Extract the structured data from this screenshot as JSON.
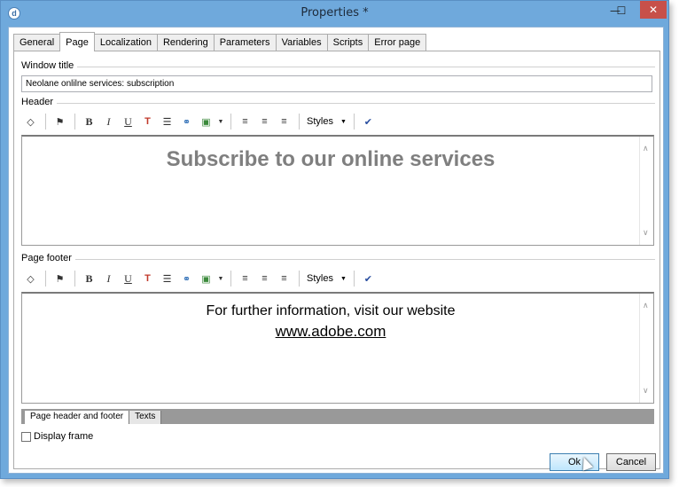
{
  "window": {
    "title": "Properties *",
    "minimize_glyph": "—",
    "maximize_glyph": "☐",
    "close_glyph": "✕",
    "app_icon_glyph": "d"
  },
  "tabs": [
    {
      "label": "General"
    },
    {
      "label": "Page"
    },
    {
      "label": "Localization"
    },
    {
      "label": "Rendering"
    },
    {
      "label": "Parameters"
    },
    {
      "label": "Variables"
    },
    {
      "label": "Scripts"
    },
    {
      "label": "Error page"
    }
  ],
  "active_tab": "Page",
  "window_title_section": {
    "label": "Window title",
    "value": "Neolane onlilne services: subscription"
  },
  "header_section": {
    "label": "Header",
    "content_heading": "Subscribe to our online services",
    "heading_color": "#7f7f7f"
  },
  "footer_section": {
    "label": "Page footer",
    "content_line1": "For further information, visit our website",
    "content_link": "www.adobe.com"
  },
  "toolbar": {
    "source_glyph": "◇",
    "find_glyph": "⚑",
    "bold": "B",
    "italic": "I",
    "underline": "U",
    "color_glyph": "T",
    "list_glyph": "☰",
    "link_glyph": "⚭",
    "image_glyph": "▣",
    "align_left_glyph": "≡",
    "align_center_glyph": "≡",
    "align_right_glyph": "≡",
    "styles_label": "Styles",
    "dropdown_glyph": "▼",
    "spellcheck_glyph": "✔"
  },
  "scroll": {
    "up_glyph": "∧",
    "down_glyph": "∨"
  },
  "bottom_tabs": [
    {
      "label": "Page header and footer"
    },
    {
      "label": "Texts"
    }
  ],
  "display_frame": {
    "label": "Display frame",
    "checked": false
  },
  "buttons": {
    "ok": "Ok",
    "cancel": "Cancel"
  }
}
